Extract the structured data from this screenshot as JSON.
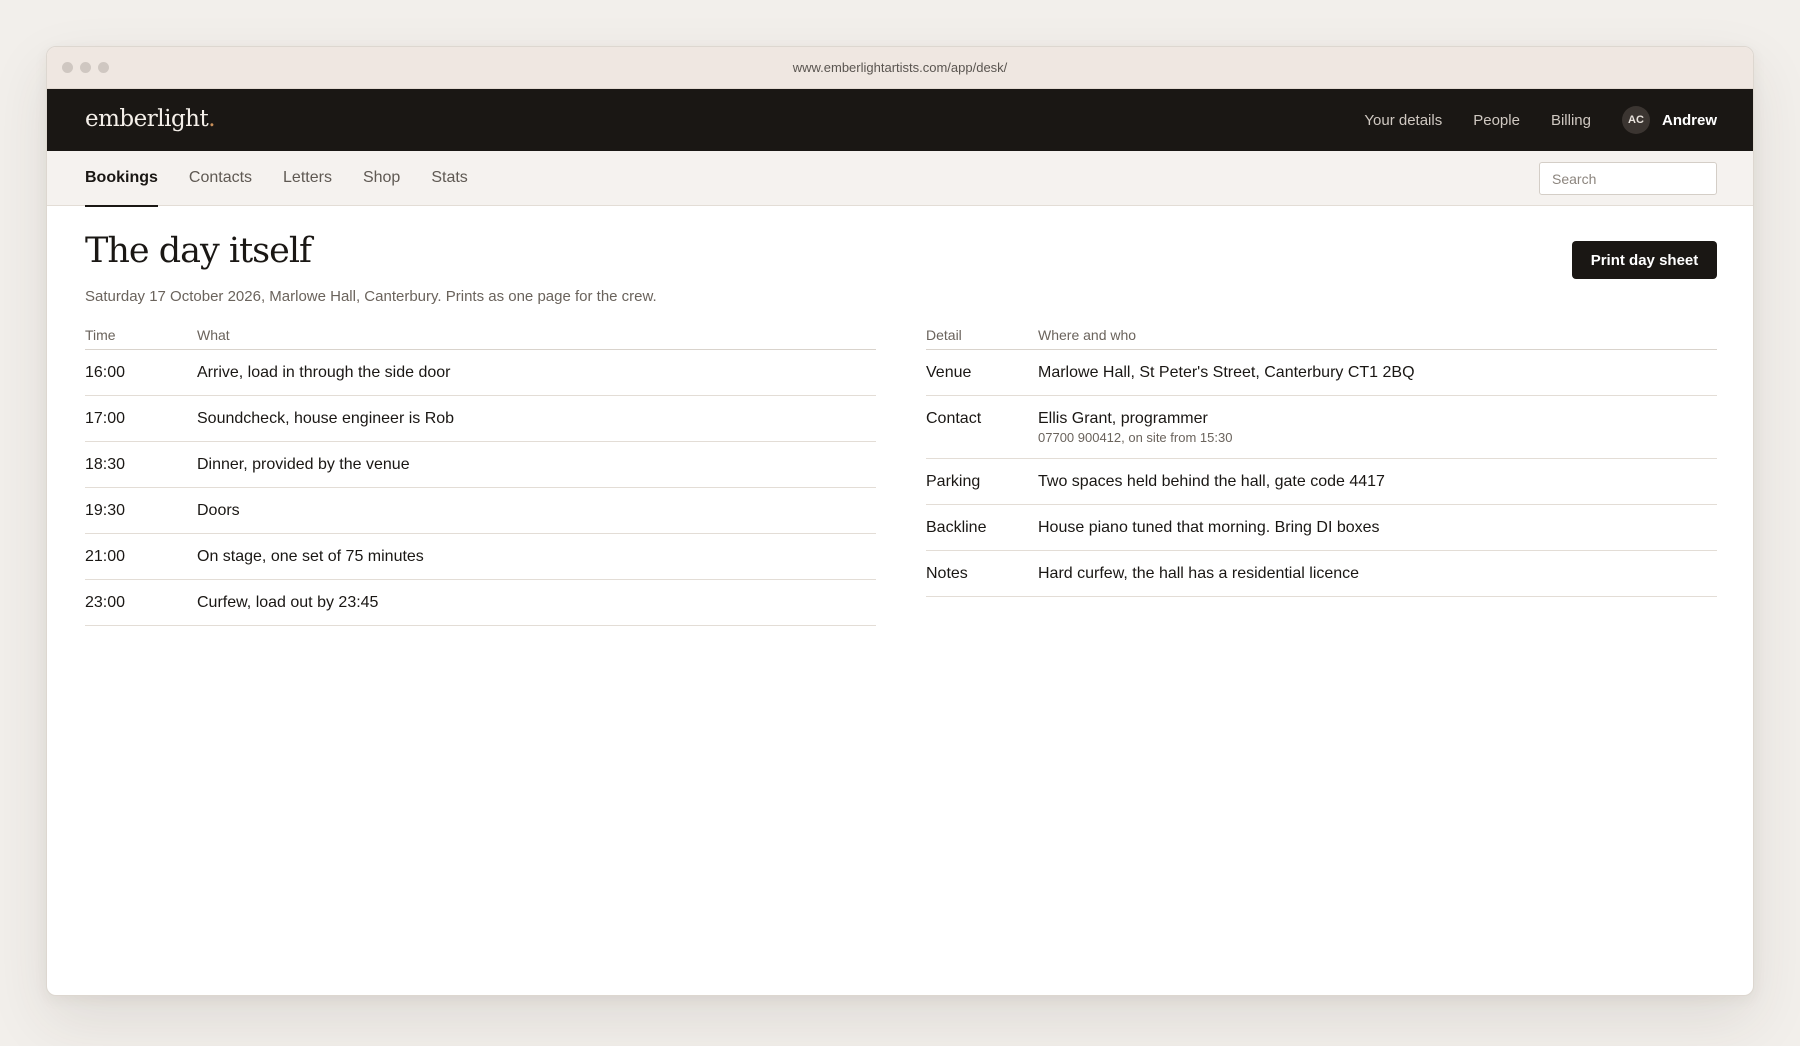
{
  "browser": {
    "url": "www.emberlightartists.com/app/desk/"
  },
  "topbar": {
    "logo": "emberlight",
    "logo_dot": ".",
    "links": [
      "Your details",
      "People",
      "Billing"
    ],
    "user": {
      "initials": "AC",
      "name": "Andrew"
    }
  },
  "subnav": {
    "tabs": [
      "Bookings",
      "Contacts",
      "Letters",
      "Shop",
      "Stats"
    ],
    "active_tab": "Bookings",
    "search_placeholder": "Search"
  },
  "page": {
    "title": "The day itself",
    "subtitle": "Saturday 17 October 2026, Marlowe Hall, Canterbury. Prints as one page for the crew.",
    "print_button": "Print day sheet"
  },
  "schedule": {
    "headers": {
      "time": "Time",
      "what": "What"
    },
    "rows": [
      {
        "time": "16:00",
        "what": "Arrive, load in through the side door"
      },
      {
        "time": "17:00",
        "what": "Soundcheck, house engineer is Rob"
      },
      {
        "time": "18:30",
        "what": "Dinner, provided by the venue"
      },
      {
        "time": "19:30",
        "what": "Doors"
      },
      {
        "time": "21:00",
        "what": "On stage, one set of 75 minutes"
      },
      {
        "time": "23:00",
        "what": "Curfew, load out by 23:45"
      }
    ]
  },
  "details": {
    "headers": {
      "detail": "Detail",
      "where": "Where and who"
    },
    "rows": [
      {
        "detail": "Venue",
        "value": "Marlowe Hall, St Peter's Street, Canterbury CT1 2BQ"
      },
      {
        "detail": "Contact",
        "value": "Ellis Grant, programmer",
        "sub": "07700 900412, on site from 15:30"
      },
      {
        "detail": "Parking",
        "value": "Two spaces held behind the hall, gate code 4417"
      },
      {
        "detail": "Backline",
        "value": "House piano tuned that morning. Bring DI boxes"
      },
      {
        "detail": "Notes",
        "value": "Hard curfew, the hall has a residential licence"
      }
    ]
  }
}
